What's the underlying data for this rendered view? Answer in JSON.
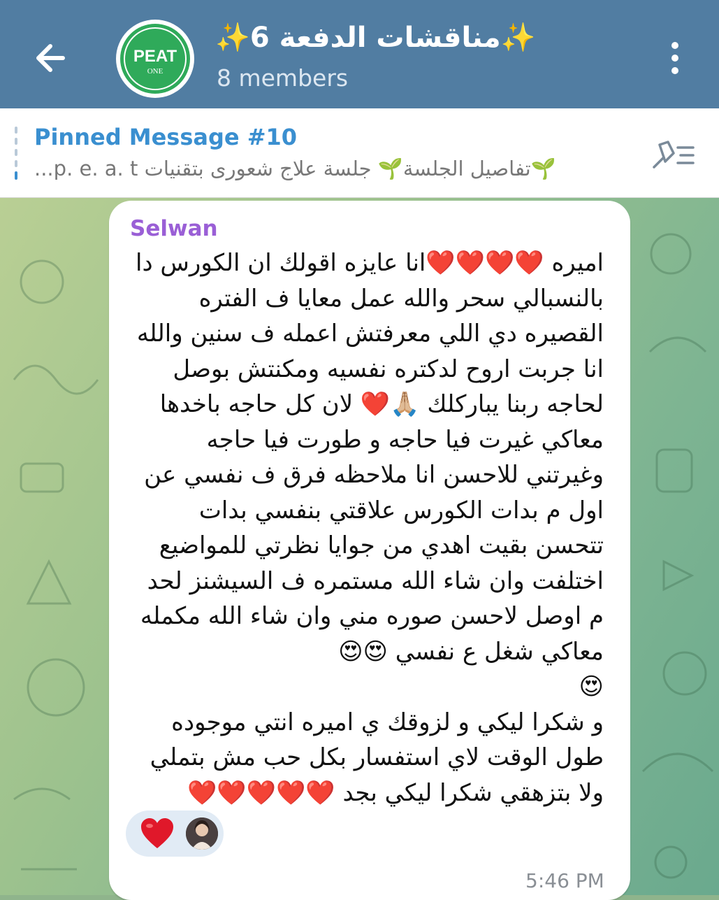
{
  "header": {
    "title": "✨مناقشات الدفعة 6✨",
    "subtitle": "8 members",
    "avatar_text": "PEAT",
    "avatar_subtext": "ONE"
  },
  "pinned": {
    "title": "Pinned Message #10",
    "text": "🌱تفاصيل الجلسة🌱 جلسة علاج شعورى بتقنيات  p. e. a. t..."
  },
  "message": {
    "sender": "Selwan",
    "text": "اميره ❤️❤️❤️❤️انا عايزه اقولك ان الكورس دا بالنسبالي سحر والله عمل معايا ف الفتره القصيره دي اللي معرفتش اعمله ف سنين والله انا جربت اروح لدكتره نفسيه ومكنتش بوصل لحاجه ربنا يباركلك 🙏🏼❤️ لان كل حاجه باخدها معاكي غيرت فيا حاجه و طورت فيا حاجه وغيرتني للاحسن انا ملاحظه فرق ف نفسي عن اول م بدات الكورس علاقتي بنفسي بدات تتحسن بقيت اهدي من جوايا نظرتي للمواضيع اختلفت وان شاء الله مستمره ف السيشنز لحد م اوصل لاحسن صوره مني وان شاء الله مكمله معاكي شغل ع نفسي 😍😍\n😍\nو شكرا ليكي و لزوقك ي اميره انتي موجوده طول الوقت لاي استفسار بكل حب مش بتملي ولا بتزهقي شكرا ليكي بجد ❤️❤️❤️❤️❤️",
    "time": "5:46 PM",
    "reaction": "❤️"
  },
  "colors": {
    "header_bg": "#517da2",
    "pinned_title": "#3a8fd0",
    "sender": "#9a5fd6",
    "heart": "#e0182a"
  }
}
